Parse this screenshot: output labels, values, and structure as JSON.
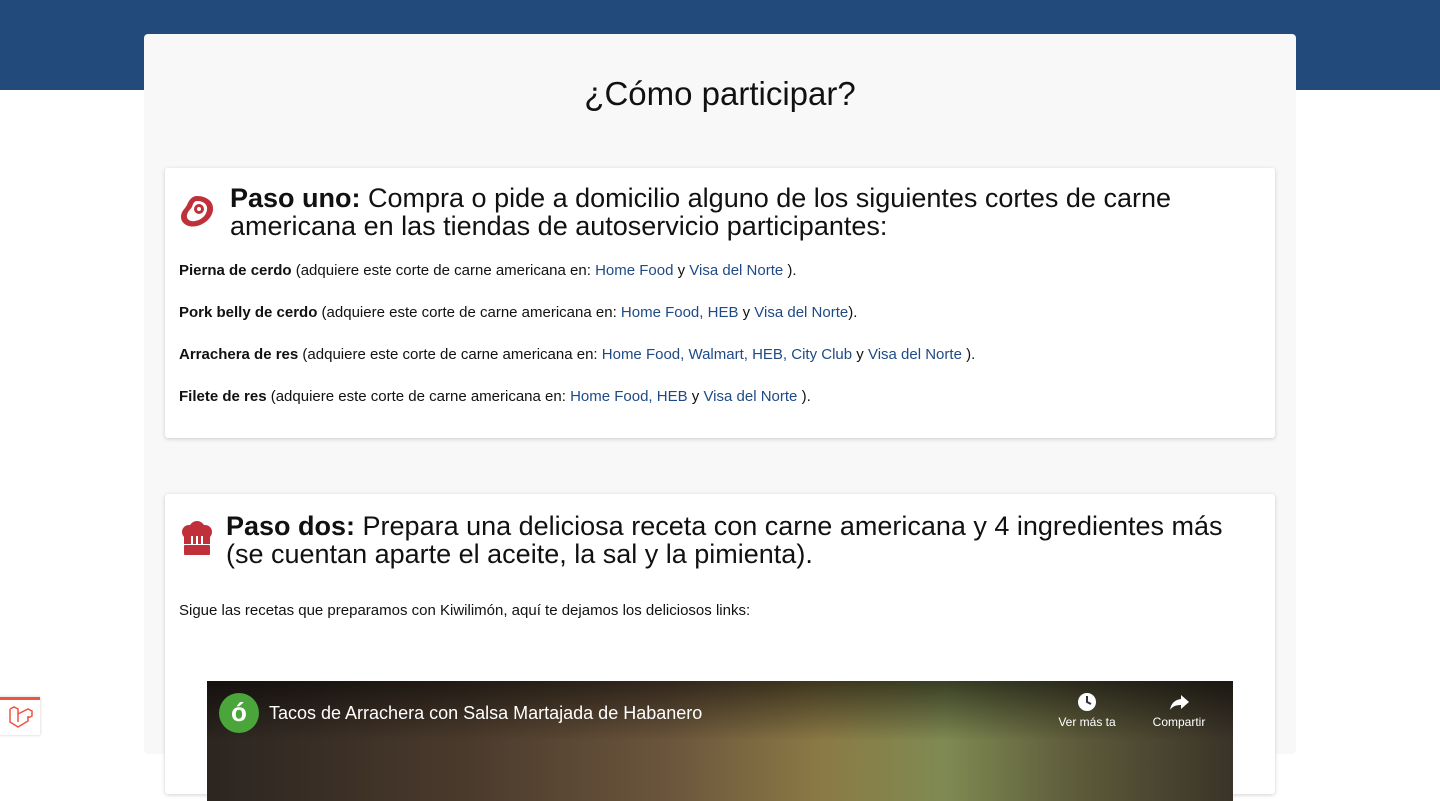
{
  "page": {
    "title": "¿Cómo participar?"
  },
  "step_one": {
    "icon": "steak-icon",
    "heading_bold": "Paso uno:",
    "heading_text": " Compra o pide a domicilio alguno de los siguientes cortes de carne americana en las tiendas de autoservicio participantes:",
    "cuts": [
      {
        "name": "Pierna de cerdo",
        "prefix": " (adquiere este corte de carne americana en: ",
        "stores_a": "Home Food",
        "sep": " y ",
        "stores_b": "Visa del Norte",
        "suffix": " )."
      },
      {
        "name": "Pork belly de cerdo",
        "prefix": " (adquiere este corte de carne americana en: ",
        "stores_a": "Home Food, HEB",
        "sep": " y ",
        "stores_b": "Visa del Norte",
        "suffix": ")."
      },
      {
        "name": "Arrachera de res",
        "prefix": " (adquiere este corte de carne americana en: ",
        "stores_a": "Home Food, Walmart, HEB,",
        "stores_a2": " City Club",
        "sep": " y ",
        "stores_b": "Visa del Norte",
        "suffix": " )."
      },
      {
        "name": "Filete de res",
        "prefix": " (adquiere este corte de carne americana en: ",
        "stores_a": "Home Food, HEB",
        "sep": " y ",
        "stores_b": "Visa del Norte",
        "suffix": " )."
      }
    ]
  },
  "step_two": {
    "icon": "chef-hat-icon",
    "heading_bold": "Paso dos:",
    "heading_text": " Prepara una deliciosa receta con carne americana y 4 ingredientes más (se cuentan aparte el aceite, la sal y la pimienta).",
    "intro": "Sigue las recetas que preparamos con Kiwilimón, aquí te dejamos los deliciosos links:"
  },
  "video": {
    "channel_initial": "ó",
    "title": "Tacos de Arrachera con Salsa Martajada de Habanero",
    "watch_later_label": "Ver más ta",
    "share_label": "Compartir"
  },
  "colors": {
    "header_band": "#224a7a",
    "link": "#1f4a85",
    "icon_red": "#c0303b"
  }
}
